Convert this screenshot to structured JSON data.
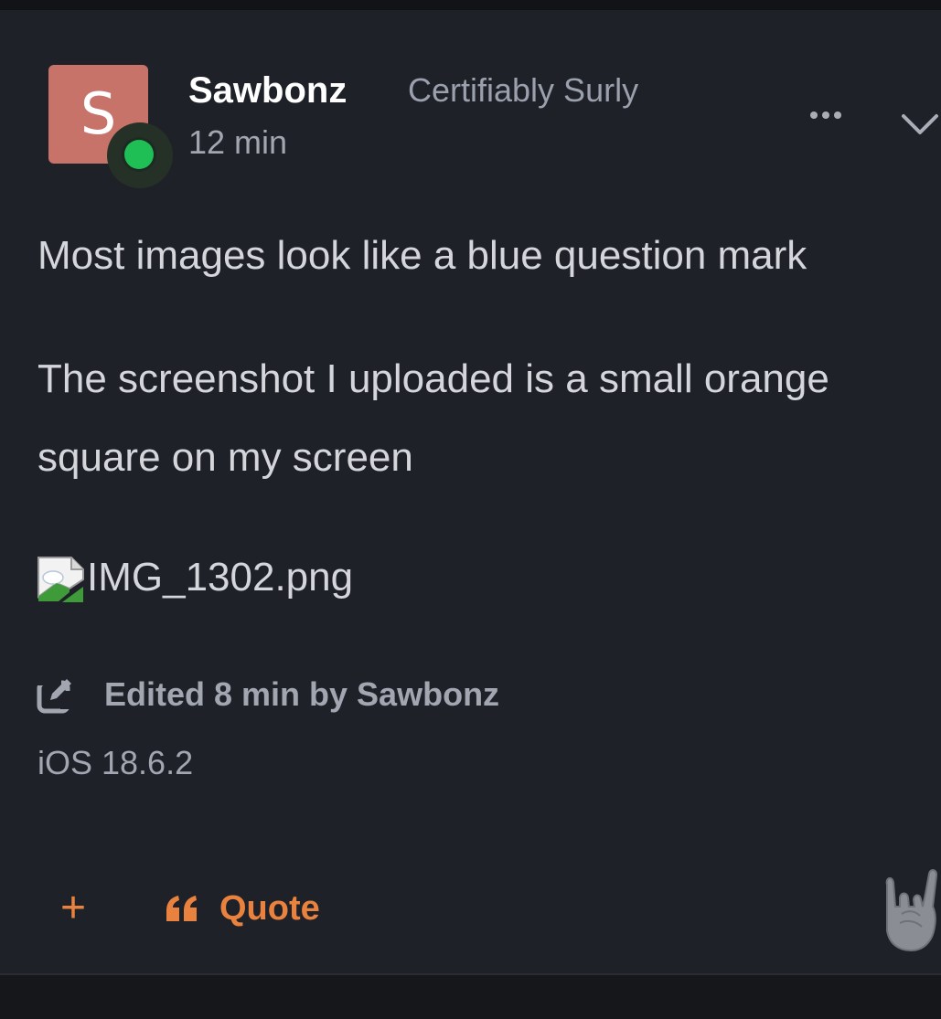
{
  "post": {
    "author": {
      "initial": "S",
      "username": "Sawbonz",
      "title": "Certifiably Surly",
      "online": true
    },
    "timestamp": "12 min",
    "body": {
      "paragraph1": "Most images look like a blue question mark",
      "paragraph2_line1": "The screenshot I uploaded is a small orange",
      "paragraph2_line2": "square on my screen",
      "image_alt": "IMG_1302.png"
    },
    "edited_text": "Edited 8 min by Sawbonz",
    "platform": "iOS 18.6.2",
    "actions": {
      "plus_label": "+",
      "quote_label": "Quote"
    }
  },
  "icons": {
    "more": "ellipsis-icon",
    "collapse": "chevron-down-icon",
    "broken_image": "broken-image-icon",
    "edit": "edit-icon",
    "quote": "quote-icon",
    "reaction": "rock-on-hand-icon"
  },
  "colors": {
    "background": "#1f2129",
    "accent": "#e8823e",
    "avatar": "#c8736a",
    "online": "#1fbf55"
  }
}
